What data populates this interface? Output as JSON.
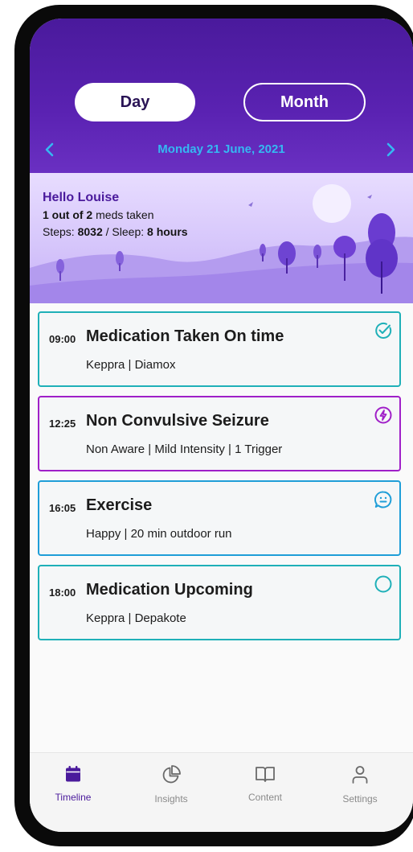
{
  "header": {
    "toggle_day": "Day",
    "toggle_month": "Month",
    "date": "Monday 21 June, 2021"
  },
  "summary": {
    "greeting": "Hello Louise",
    "meds_count": "1 out of 2",
    "meds_suffix": " meds taken",
    "steps_label": "Steps: ",
    "steps_value": "8032",
    "sleep_label": " / Sleep: ",
    "sleep_value": "8 hours"
  },
  "timeline": [
    {
      "time": "09:00",
      "title": "Medication Taken On time",
      "detail": "Keppra  |  Diamox",
      "status_icon": "check-circle-icon",
      "color": "#1fb0b8"
    },
    {
      "time": "12:25",
      "title": "Non Convulsive Seizure",
      "detail": "Non Aware  |  Mild Intensity  |  1 Trigger",
      "status_icon": "lightning-circle-icon",
      "color": "#a020c8"
    },
    {
      "time": "16:05",
      "title": "Exercise",
      "detail": "Happy  |  20 min outdoor run",
      "status_icon": "smiley-chat-icon",
      "color": "#1f9ed8"
    },
    {
      "time": "18:00",
      "title": "Medication Upcoming",
      "detail": "Keppra  |  Depakote",
      "status_icon": "empty-circle-icon",
      "color": "#1fb0b8"
    }
  ],
  "tabbar": {
    "items": [
      {
        "label": "Timeline",
        "icon": "calendar-icon",
        "active": true
      },
      {
        "label": "Insights",
        "icon": "pie-chart-icon",
        "active": false
      },
      {
        "label": "Content",
        "icon": "book-icon",
        "active": false
      },
      {
        "label": "Settings",
        "icon": "user-icon",
        "active": false
      }
    ]
  },
  "colors": {
    "brand": "#4a1a9c",
    "date_accent": "#35b8f2"
  }
}
